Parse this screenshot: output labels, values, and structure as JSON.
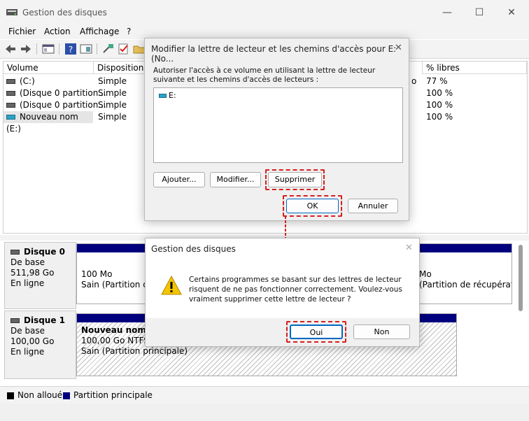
{
  "main_window": {
    "title": "Gestion des disques",
    "window_controls": {
      "minimize": "—",
      "maximize": "☐",
      "close": "✕"
    },
    "menu": [
      "Fichier",
      "Action",
      "Affichage",
      "?"
    ],
    "volume_list": {
      "columns": [
        "Volume",
        "Disposition",
        "% libres"
      ],
      "rows": [
        {
          "volume": "(C:)",
          "layout": "Simple",
          "free_partial": "o",
          "free_pct": "77 %"
        },
        {
          "volume": "(Disque 0 partition...",
          "layout": "Simple",
          "free_partial": "",
          "free_pct": "100 %"
        },
        {
          "volume": "(Disque 0 partition...",
          "layout": "Simple",
          "free_partial": "",
          "free_pct": "100 %"
        },
        {
          "volume": "Nouveau nom (E:)",
          "layout": "Simple",
          "free_partial": "",
          "free_pct": "100 %"
        }
      ]
    },
    "disks": [
      {
        "name": "Disque 0",
        "type": "De base",
        "size": "511,98 Go",
        "status": "En ligne",
        "part_left": {
          "size": "100 Mo",
          "status": "Sain (Partition du"
        },
        "part_right": {
          "size": "Mo",
          "status": "(Partition de récupératio"
        }
      },
      {
        "name": "Disque 1",
        "type": "De base",
        "size": "100,00 Go",
        "status": "En ligne",
        "partition": {
          "name": "Nouveau nom  (E:)",
          "fs": "100,00 Go NTFS",
          "status": "Sain (Partition principale)"
        }
      }
    ],
    "legend": [
      {
        "label": "Non alloué",
        "color": "#000000"
      },
      {
        "label": "Partition principale",
        "color": "#00007f"
      }
    ]
  },
  "dialog1": {
    "title": "Modifier la lettre de lecteur et les chemins d'accès pour E: (No...",
    "close": "✕",
    "description": "Autoriser l'accès à ce volume en utilisant la lettre de lecteur suivante et les chemins d'accès de lecteurs :",
    "list_items": [
      "E:"
    ],
    "buttons": {
      "add": "Ajouter...",
      "modify": "Modifier...",
      "remove": "Supprimer",
      "ok": "OK",
      "cancel": "Annuler"
    }
  },
  "dialog2": {
    "title": "Gestion des disques",
    "close": "✕",
    "message": "Certains programmes se basant sur des lettres de lecteur risquent de ne pas fonctionner correctement. Voulez-vous vraiment supprimer cette lettre de lecteur ?",
    "buttons": {
      "yes": "Oui",
      "no": "Non"
    }
  },
  "colors": {
    "partition_bar": "#00007f",
    "highlight": "#d81e1e",
    "warning": "#f5c400"
  }
}
